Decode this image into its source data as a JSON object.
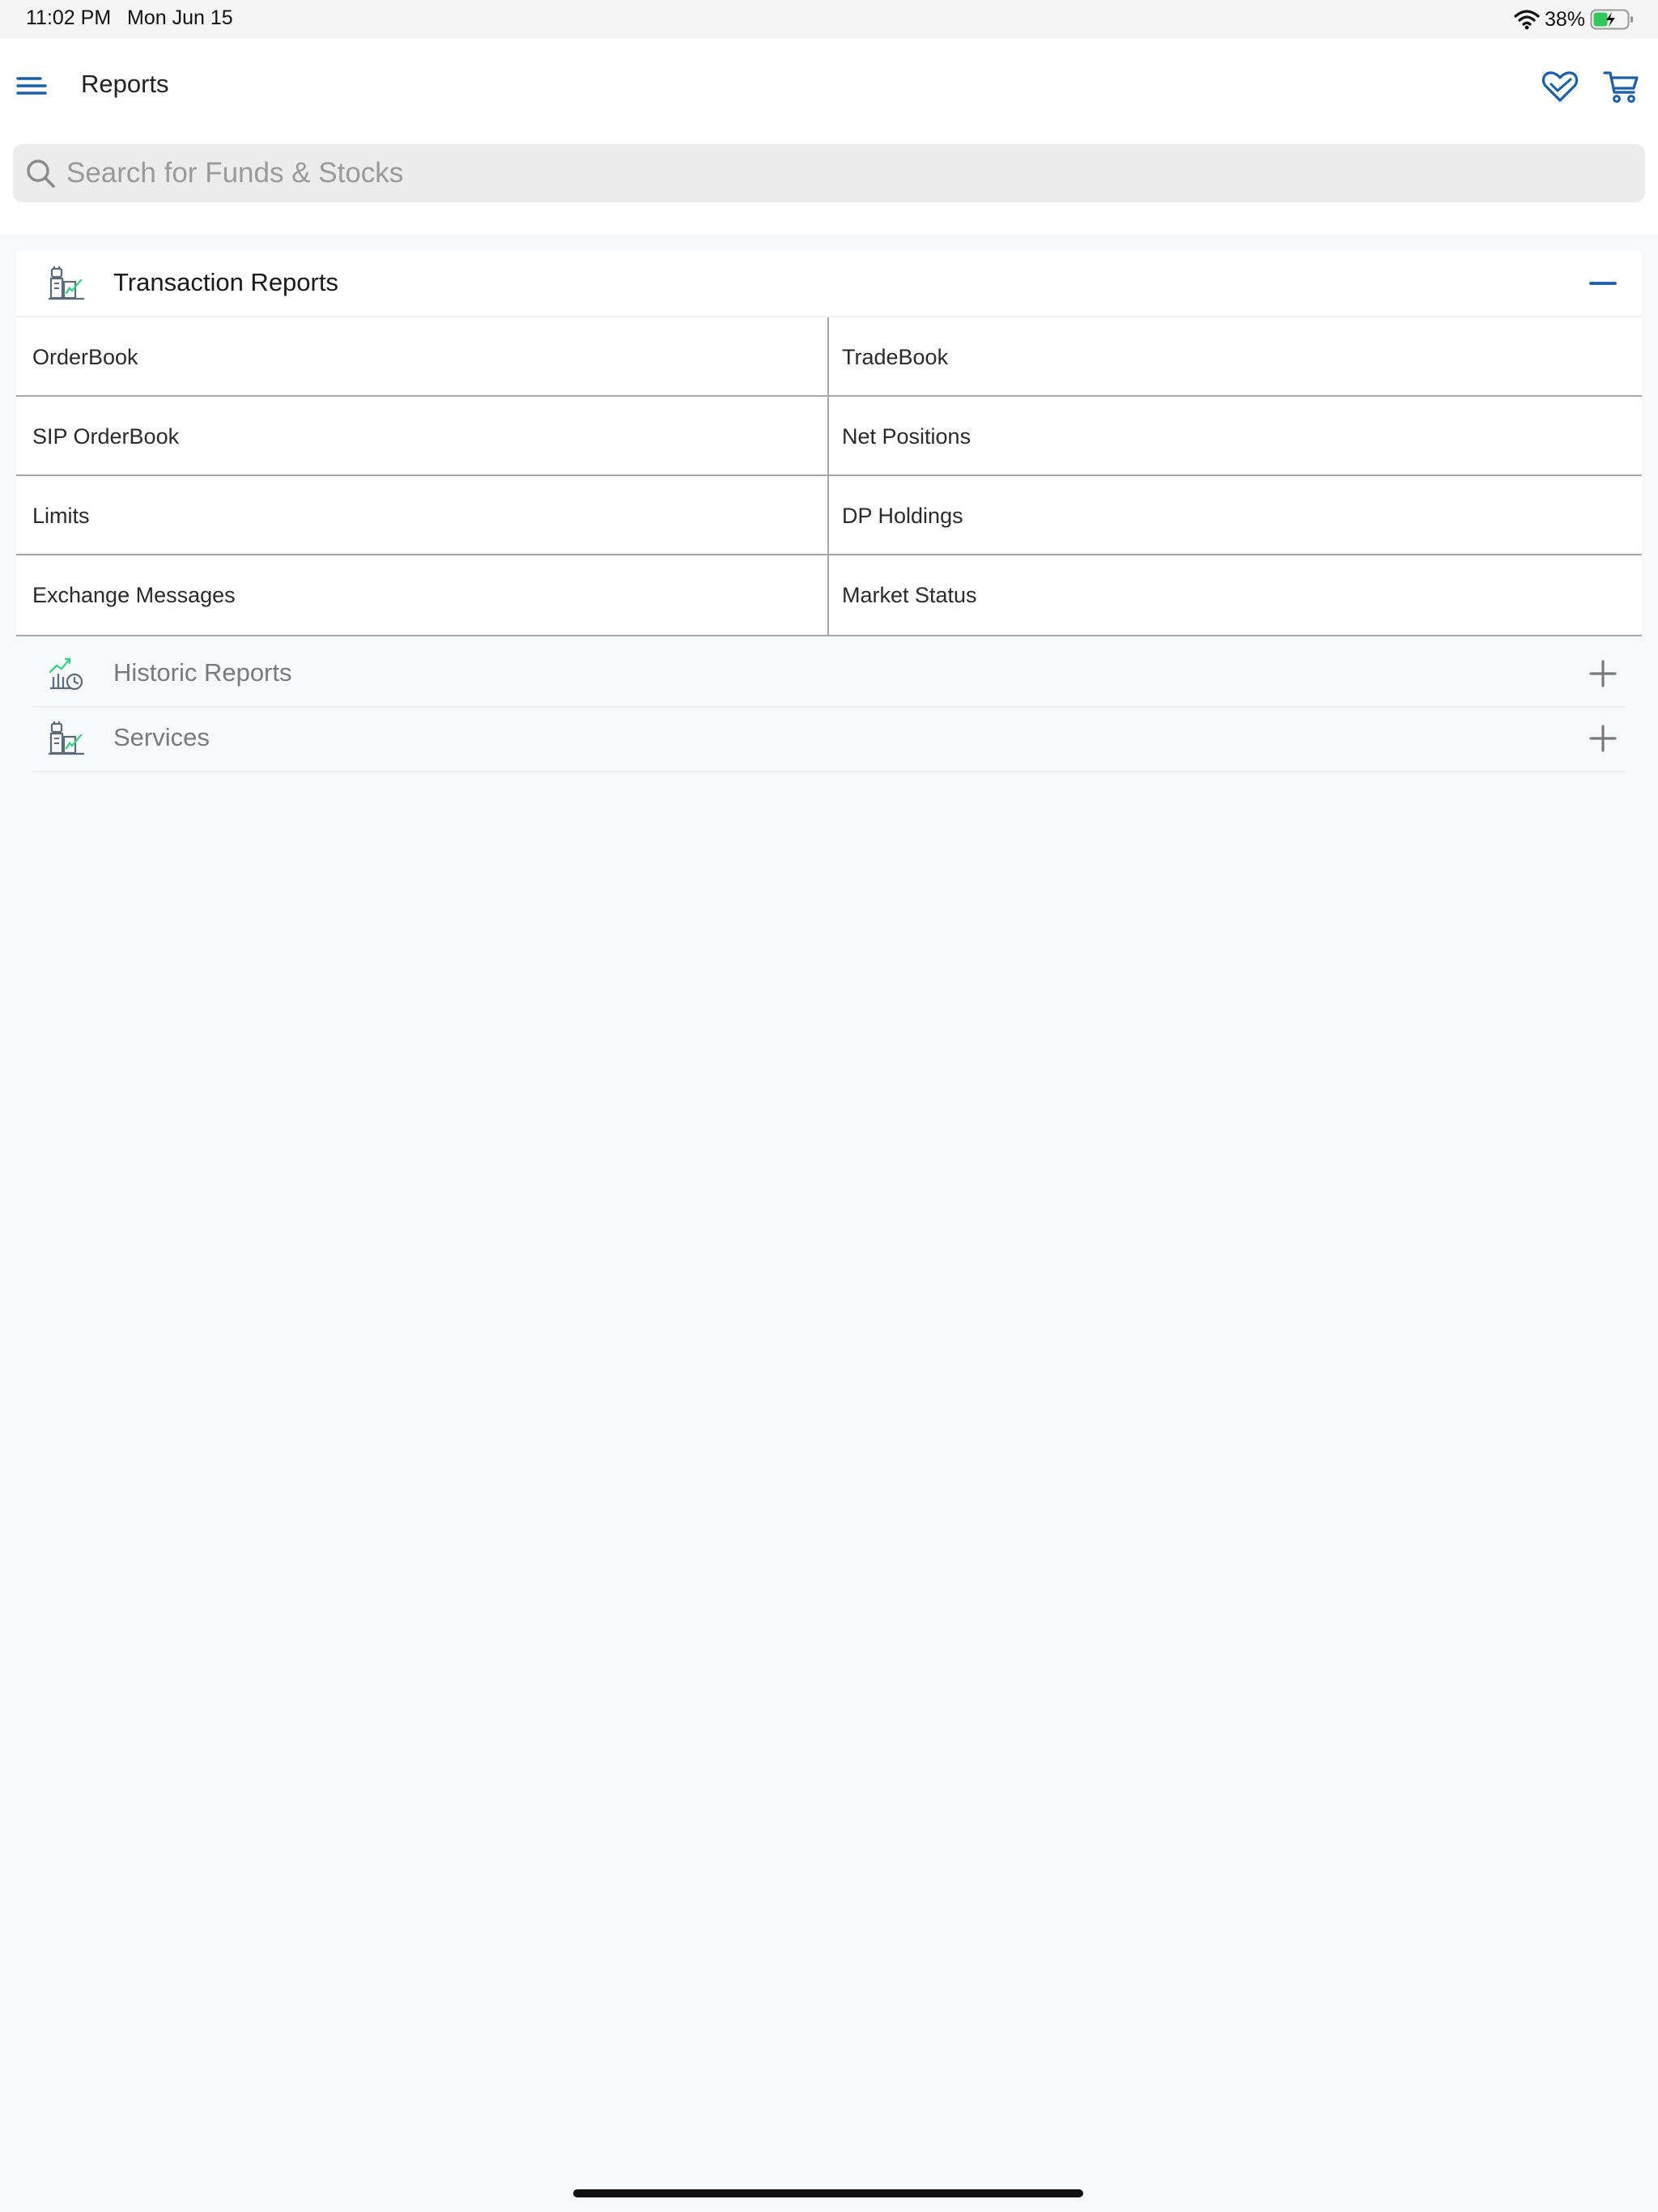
{
  "status_bar": {
    "time": "11:02 PM",
    "date": "Mon Jun 15",
    "battery_percent": "38%",
    "wifi_icon": "wifi-icon",
    "battery_icon": "battery-charging-icon"
  },
  "header": {
    "title": "Reports",
    "menu_icon": "menu-icon",
    "favorites_icon": "heart-icon",
    "cart_icon": "cart-icon"
  },
  "search": {
    "placeholder": "Search for Funds & Stocks",
    "value": ""
  },
  "sections": [
    {
      "title": "Transaction Reports",
      "icon": "reports-icon",
      "expanded": true,
      "items": [
        "OrderBook",
        "TradeBook",
        "SIP OrderBook",
        "Net Positions",
        "Limits",
        "DP Holdings",
        "Exchange Messages",
        "Market Status"
      ]
    },
    {
      "title": "Historic Reports",
      "icon": "historic-chart-icon",
      "expanded": false
    },
    {
      "title": "Services",
      "icon": "services-icon",
      "expanded": false
    }
  ],
  "colors": {
    "accent": "#1a5fa8",
    "icon_green": "#3ecf8e",
    "icon_gray": "#5a6b7b",
    "background": "#f8f9fb"
  }
}
